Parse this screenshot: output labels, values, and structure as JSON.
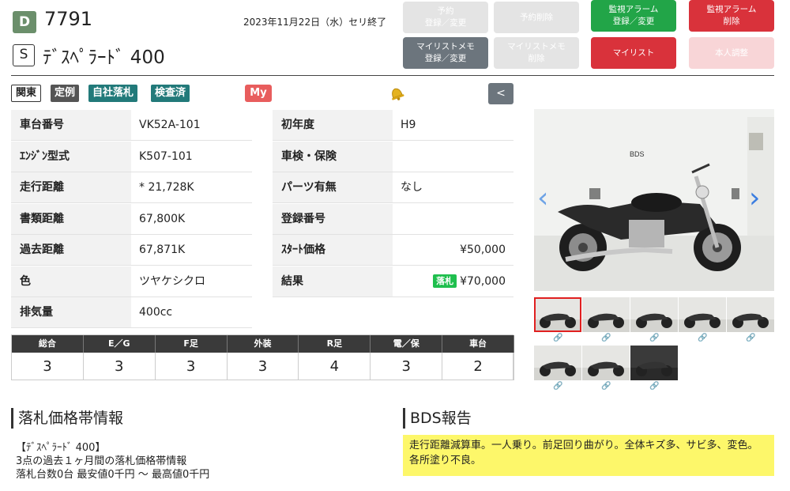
{
  "header": {
    "lot_letter": "D",
    "lot_number": "7791",
    "rank": "S",
    "model_name": "ﾃﾞｽﾍﾟﾗｰﾄﾞ 400",
    "auction_date": "2023年11月22日（水）セリ終了"
  },
  "actions": {
    "reserve_register": "予約\n登録／変更",
    "reserve_delete": "予約削除",
    "alarm_register": "監視アラーム\n登録／変更",
    "alarm_delete": "監視アラーム\n削除",
    "mylist_memo_register": "マイリストメモ\n登録／変更",
    "mylist_memo_delete": "マイリストメモ\n削除",
    "mylist": "マイリスト",
    "self_adjust": "本人調整"
  },
  "tags": {
    "region": "関東",
    "regular": "定例",
    "company": "自社落札",
    "inspected": "検査済",
    "my": "My",
    "back": "<"
  },
  "specs": {
    "left": [
      {
        "key": "車台番号",
        "value": "VK52A-101"
      },
      {
        "key": "ｴﾝｼﾞﾝ型式",
        "value": "K507-101"
      },
      {
        "key": "走行距離",
        "value": "* 21,728K"
      },
      {
        "key": "書類距離",
        "value": "67,800K"
      },
      {
        "key": "過去距離",
        "value": "67,871K"
      },
      {
        "key": "色",
        "value": "ツヤケシクロ"
      },
      {
        "key": "排気量",
        "value": "400cc"
      }
    ],
    "right": [
      {
        "key": "初年度",
        "value": "H9"
      },
      {
        "key": "車検・保険",
        "value": ""
      },
      {
        "key": "パーツ有無",
        "value": "なし"
      },
      {
        "key": "登録番号",
        "value": ""
      },
      {
        "key": "ｽﾀｰﾄ価格",
        "value": "¥50,000"
      },
      {
        "key": "結果",
        "value": "¥70,000",
        "badge": "落札"
      }
    ]
  },
  "grades": {
    "headers": [
      "総合",
      "E／G",
      "F足",
      "外装",
      "R足",
      "電／保",
      "車台"
    ],
    "values": [
      "3",
      "3",
      "3",
      "3",
      "4",
      "3",
      "2"
    ]
  },
  "gallery": {
    "prev_icon": "chevron-left-icon",
    "next_icon": "chevron-right-icon",
    "thumb_count": 8,
    "active_index": 0,
    "main_photo_text": "BDS"
  },
  "price_band": {
    "title": "落札価格帯情報",
    "text": "【ﾃﾞｽﾍﾟﾗｰﾄﾞ 400】\n3点の過去１ヶ月間の落札価格帯情報\n落札台数0台 最安値0千円 〜 最高値0千円"
  },
  "bds_report": {
    "title": "BDS報告",
    "text": "走行距離減算車。一人乗り。前足回り曲がり。全体キズ多、サビ多、変色。各所塗り不良。"
  },
  "colors": {
    "accent_green": "#22a548",
    "accent_red": "#d9323b",
    "teal": "#227a7a",
    "report_yellow": "#fdf76a"
  }
}
